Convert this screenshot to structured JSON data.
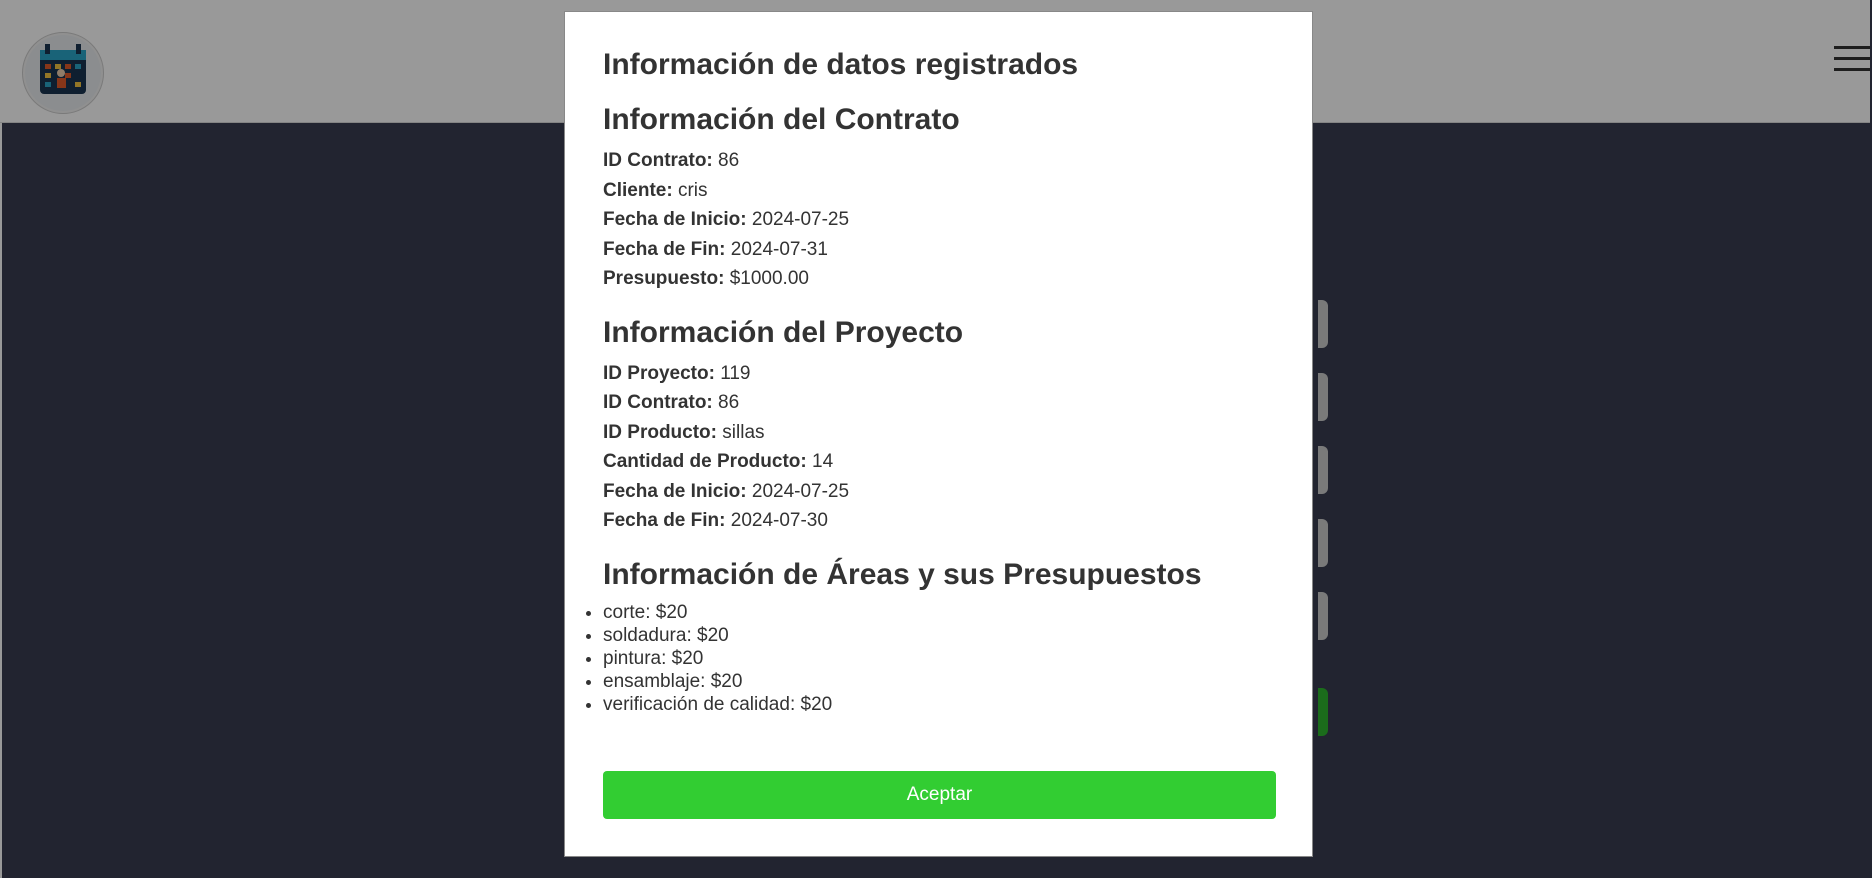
{
  "modal": {
    "title": "Información de datos registrados",
    "contract": {
      "heading": "Información del Contrato",
      "rows": [
        {
          "label": "ID Contrato:",
          "value": "86"
        },
        {
          "label": "Cliente:",
          "value": "cris"
        },
        {
          "label": "Fecha de Inicio:",
          "value": "2024-07-25"
        },
        {
          "label": "Fecha de Fin:",
          "value": "2024-07-31"
        },
        {
          "label": "Presupuesto:",
          "value": "$1000.00"
        }
      ]
    },
    "project": {
      "heading": "Información del Proyecto",
      "rows": [
        {
          "label": "ID Proyecto:",
          "value": "119"
        },
        {
          "label": "ID Contrato:",
          "value": "86"
        },
        {
          "label": "ID Producto:",
          "value": "sillas"
        },
        {
          "label": "Cantidad de Producto:",
          "value": "14"
        },
        {
          "label": "Fecha de Inicio:",
          "value": "2024-07-25"
        },
        {
          "label": "Fecha de Fin:",
          "value": "2024-07-30"
        }
      ]
    },
    "areas": {
      "heading": "Información de Áreas y sus Presupuestos",
      "items": [
        "corte: $20",
        "soldadura: $20",
        "pintura: $20",
        "ensamblaje: $20",
        "verificación de calidad: $20"
      ]
    },
    "accept_label": "Aceptar"
  },
  "icons": {
    "logo": "logo-icon",
    "menu": "hamburger-menu-icon"
  },
  "colors": {
    "accept_button": "#32cd32",
    "page_background": "#393c50"
  }
}
